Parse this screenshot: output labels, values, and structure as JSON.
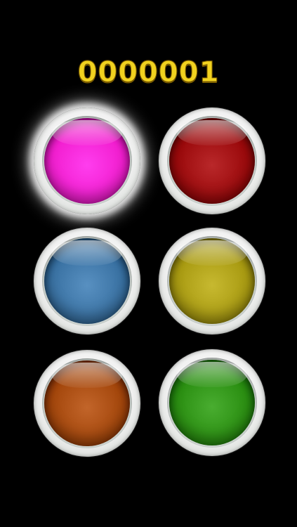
{
  "game": {
    "score": "0000001"
  },
  "pads": [
    {
      "id": "pink",
      "color": "#f21fd0",
      "active": true
    },
    {
      "id": "red",
      "color": "#9b0a0c",
      "active": false
    },
    {
      "id": "blue",
      "color": "#3a72a3",
      "active": false
    },
    {
      "id": "yellow",
      "color": "#a99b12",
      "active": false
    },
    {
      "id": "orange",
      "color": "#a4470c",
      "active": false
    },
    {
      "id": "green",
      "color": "#2b8f12",
      "active": false
    }
  ],
  "colors": {
    "background": "#000000",
    "score_text": "#f1d21f"
  }
}
